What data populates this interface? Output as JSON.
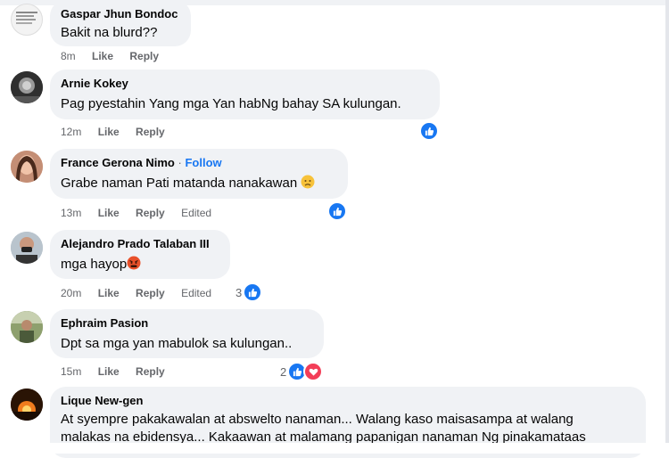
{
  "comments": [
    {
      "author": "Gaspar Jhun Bondoc",
      "text": "Bakit na blurd??",
      "time": "8m",
      "like": "Like",
      "reply": "Reply"
    },
    {
      "author": "Arnie Kokey",
      "text": "Pag pyestahin Yang mga Yan habNg bahay SA kulungan.",
      "time": "12m",
      "like": "Like",
      "reply": "Reply"
    },
    {
      "author": "France Gerona Nimo",
      "separator": "·",
      "follow": "Follow",
      "text": "Grabe naman Pati matanda nanakawan",
      "time": "13m",
      "like": "Like",
      "reply": "Reply",
      "edited": "Edited"
    },
    {
      "author": "Alejandro Prado Talaban III",
      "text": "mga hayop",
      "time": "20m",
      "like": "Like",
      "reply": "Reply",
      "edited": "Edited",
      "reaction_count": "3"
    },
    {
      "author": "Ephraim Pasion",
      "text": "Dpt sa mga yan mabulok sa kulungan..",
      "time": "15m",
      "like": "Like",
      "reply": "Reply",
      "reaction_count": "2"
    },
    {
      "author": "Lique New-gen",
      "text_line1": "At syempre pakakawalan at abswelto nanaman... Walang kaso maisasampa at walang",
      "text_line2": "malakas na ebidensya... Kakaawan at malamang papanigan nanaman Ng pinakamataas"
    }
  ],
  "icons": {
    "like": "thumbs-up-icon",
    "love": "heart-icon",
    "sad": "sad-face-emoji",
    "angry": "angry-face-emoji"
  },
  "colors": {
    "bubble": "#f0f2f5",
    "link": "#1877f2",
    "meta": "#65676b",
    "like_badge": "#1877f2",
    "love_badge": "#f33e58"
  }
}
